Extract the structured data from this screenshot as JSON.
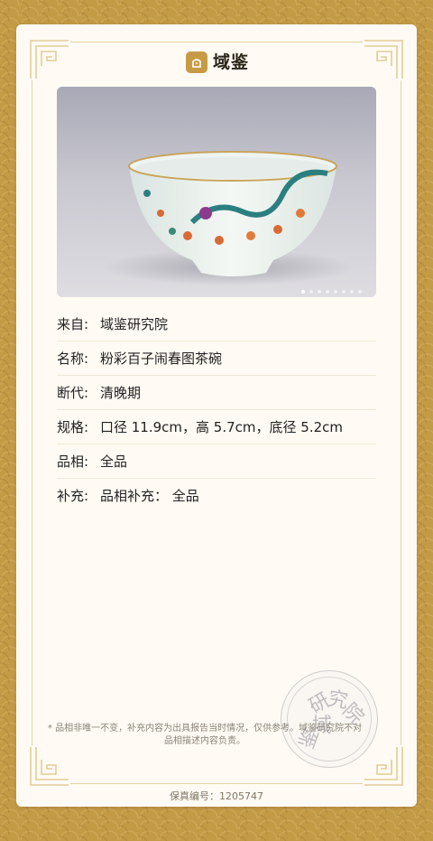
{
  "brand": {
    "name": "域鉴",
    "tagline": "",
    "accent": "#c79b46"
  },
  "photo": {
    "alt_icon": "porcelain-bowl-photo",
    "slide_count": 8,
    "active_slide": 1
  },
  "fields": [
    {
      "key": "来自:",
      "value": "域鉴研究院"
    },
    {
      "key": "名称:",
      "value": "粉彩百子闹春图茶碗"
    },
    {
      "key": "断代:",
      "value": "清晚期"
    },
    {
      "key": "规格:",
      "value": "口径 11.9cm，高 5.7cm，底径 5.2cm"
    },
    {
      "key": "品相:",
      "value": "全品"
    },
    {
      "key": "补充:",
      "value": "品相补充： 全品"
    }
  ],
  "seal": {
    "chars": [
      "域",
      "鉴",
      "研",
      "究",
      "院"
    ]
  },
  "disclaimer": "* 品相非唯一不变，补充内容为出具报告当时情况，仅供参考。域鉴研究院不对品相描述内容负责。",
  "serial": {
    "label": "保真编号：",
    "number": "1205747"
  }
}
